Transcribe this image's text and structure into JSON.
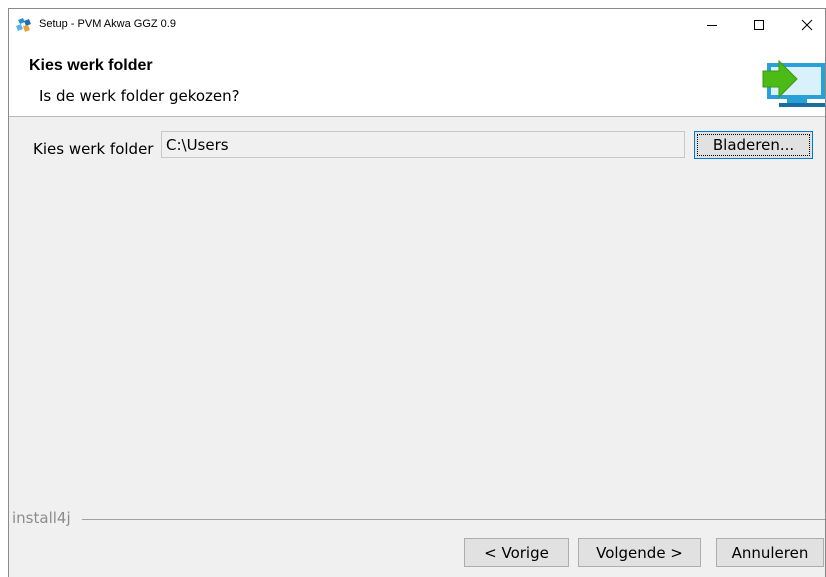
{
  "window": {
    "title": "Setup - PVM Akwa GGZ 0.9",
    "controls": [
      "minimize-icon",
      "maximize-icon",
      "close-icon"
    ]
  },
  "header": {
    "title": "Kies werk folder",
    "subtitle": "Is de werk folder gekozen?",
    "graphic": "install-computer-arrow-icon"
  },
  "form": {
    "folder_label": "Kies werk folder",
    "folder_value": "C:\\Users",
    "browse_label": "Bladeren..."
  },
  "footer": {
    "brand": "install4j",
    "prev_label": "< Vorige",
    "next_label": "Volgende >",
    "cancel_label": "Annuleren"
  },
  "colors": {
    "accent": "#0078d7",
    "arrow": "#4cbb17",
    "monitor": "#2aa0d8"
  }
}
